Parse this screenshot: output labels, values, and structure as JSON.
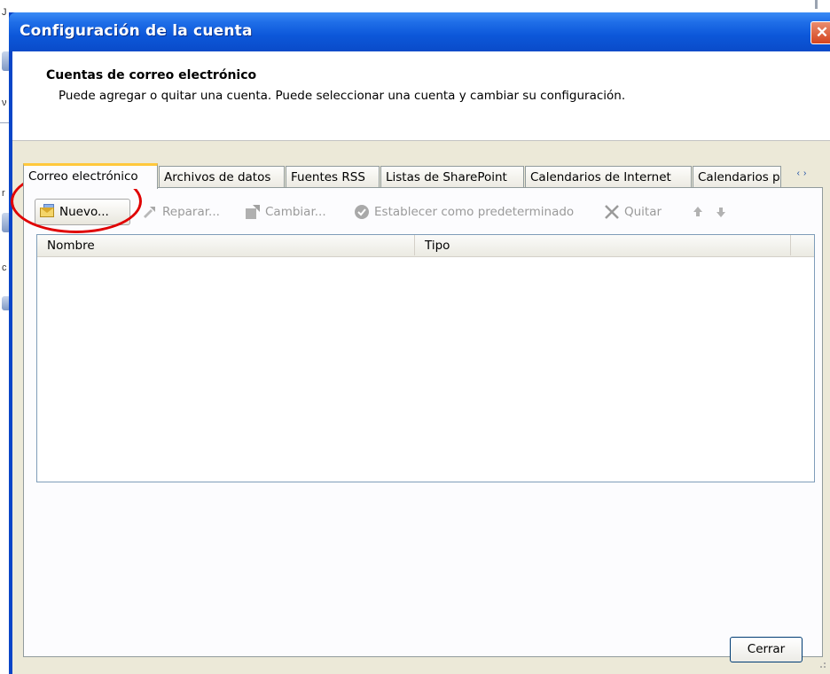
{
  "window": {
    "title": "Configuración de la cuenta"
  },
  "header": {
    "title": "Cuentas de correo electrónico",
    "description": "Puede agregar o quitar una cuenta. Puede seleccionar una cuenta y cambiar su configuración."
  },
  "tabs": [
    {
      "label": "Correo electrónico",
      "active": true
    },
    {
      "label": "Archivos de datos",
      "active": false
    },
    {
      "label": "Fuentes RSS",
      "active": false
    },
    {
      "label": "Listas de SharePoint",
      "active": false
    },
    {
      "label": "Calendarios de Internet",
      "active": false
    },
    {
      "label": "Calendarios p",
      "active": false
    }
  ],
  "tab_scroll": {
    "left": "‹",
    "right": "›"
  },
  "toolbar": {
    "new_label": "Nuevo...",
    "repair_label": "Reparar...",
    "change_label": "Cambiar...",
    "set_default_label": "Establecer como predeterminado",
    "remove_label": "Quitar",
    "icons": {
      "new": "mail-icon",
      "repair": "repair-icon",
      "change": "change-icon",
      "set_default": "check-circle-icon",
      "remove": "x-icon",
      "up": "arrow-up-icon",
      "down": "arrow-down-icon"
    }
  },
  "list": {
    "columns": [
      "Nombre",
      "Tipo"
    ],
    "rows": []
  },
  "footer": {
    "close_label": "Cerrar"
  },
  "background": {
    "left_edge_glyphs": [
      "J",
      "ν",
      "r",
      "c"
    ]
  },
  "colors": {
    "titlebar": "#0a4bc9",
    "client": "#ece9d8",
    "active_tab_accent": "#ffc83c",
    "annotation": "#e00000"
  }
}
